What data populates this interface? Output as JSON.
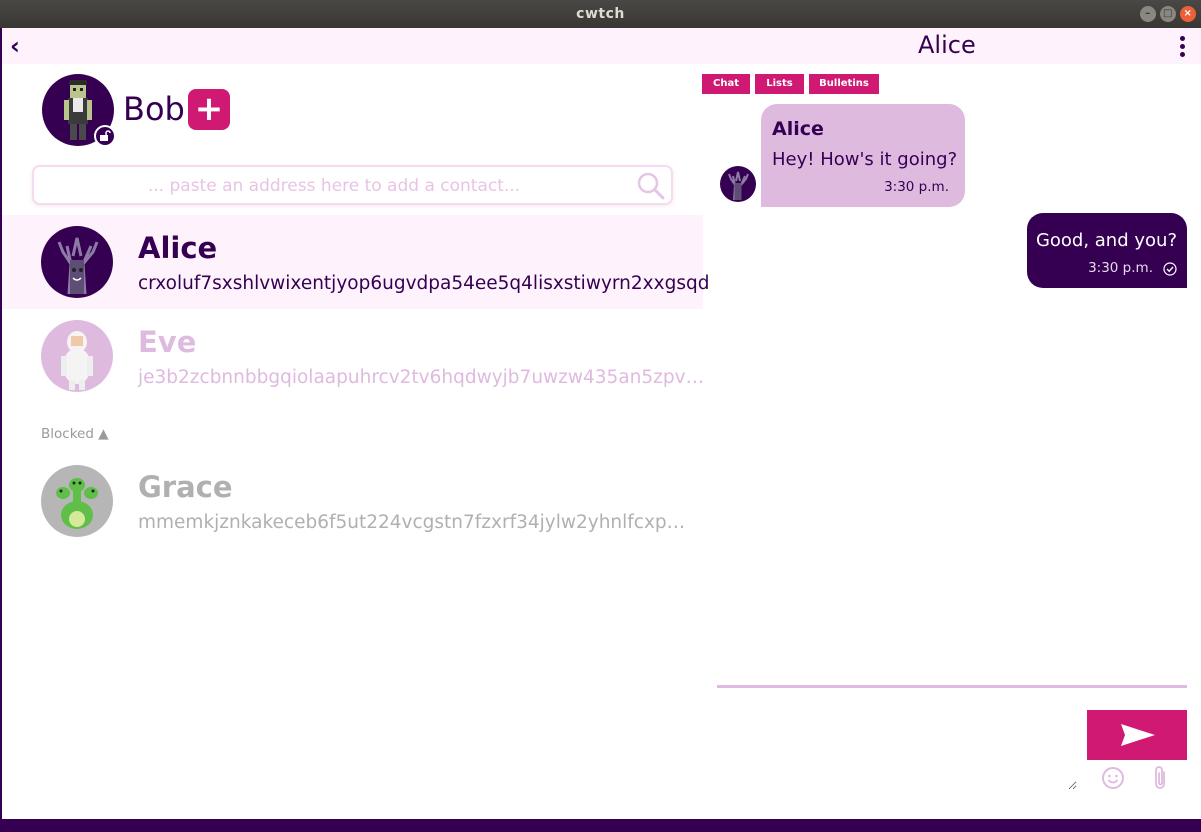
{
  "window": {
    "title": "cwtch"
  },
  "topbar": {
    "conversation_title": "Alice"
  },
  "profile": {
    "name": "Bob"
  },
  "search": {
    "placeholder": "... paste an address here to add a contact..."
  },
  "contacts": [
    {
      "name": "Alice",
      "address": "crxoluf7sxshlvwixentjyop6ugvdpa54ee5q4lisxstiwyrn2xxgsqd",
      "name_color": "#350052",
      "address_color": "#350052"
    },
    {
      "name": "Eve",
      "address": "je3b2zcbnnbbgqiolaapuhrcv2tv6hqdwyjb7uwzw435an5zpv…",
      "name_color": "#dfbadf",
      "address_color": "#dfbadf"
    }
  ],
  "blocked": {
    "label": "Blocked ▲",
    "contacts": [
      {
        "name": "Grace",
        "address": "mmemkjznkakeceb6f5ut224vcgstn7fzxrf34jylw2yhnlfcxp…",
        "name_color": "#b0b0b0",
        "address_color": "#b0b0b0"
      }
    ]
  },
  "tabs": [
    "Chat",
    "Lists",
    "Bulletins"
  ],
  "messages": [
    {
      "direction": "incoming",
      "sender": "Alice",
      "text": "Hey! How's it going?",
      "time": "3:30 p.m."
    },
    {
      "direction": "outgoing",
      "text": "Good, and you?",
      "time": "3:30 p.m."
    }
  ],
  "colors": {
    "accent": "#d01972",
    "primary": "#350052",
    "light": "#dfbadf",
    "panel": "#fef3fc"
  },
  "icons": {
    "back": "back-arrow-icon",
    "menu": "kebab-menu-icon",
    "add": "plus-icon",
    "search": "search-icon",
    "lock": "unlocked-padlock-icon",
    "send": "send-icon",
    "emoji": "emoji-icon",
    "attach": "paperclip-icon"
  }
}
